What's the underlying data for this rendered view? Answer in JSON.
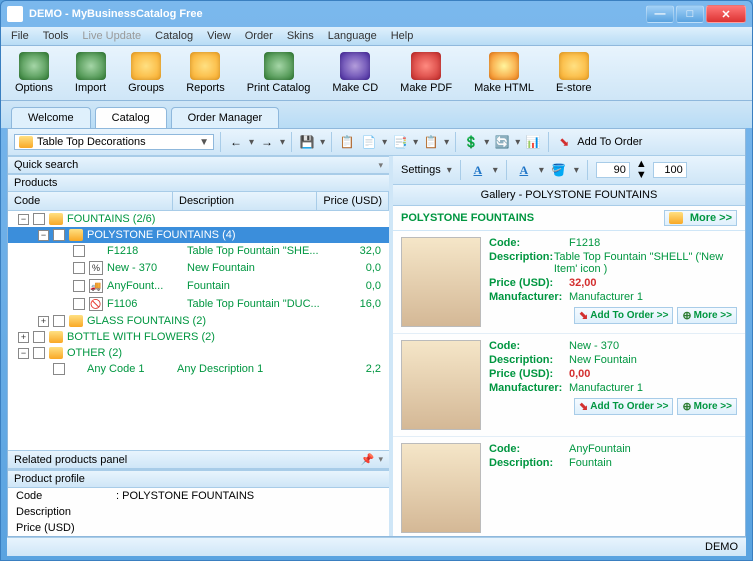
{
  "window": {
    "title": "DEMO - MyBusinessCatalog Free"
  },
  "menu": {
    "file": "File",
    "tools": "Tools",
    "live_update": "Live Update",
    "catalog": "Catalog",
    "view": "View",
    "order": "Order",
    "skins": "Skins",
    "language": "Language",
    "help": "Help"
  },
  "toolbar": {
    "options": "Options",
    "import": "Import",
    "groups": "Groups",
    "reports": "Reports",
    "print_catalog": "Print Catalog",
    "make_cd": "Make CD",
    "make_pdf": "Make PDF",
    "make_html": "Make HTML",
    "estore": "E-store"
  },
  "tabs": {
    "welcome": "Welcome",
    "catalog": "Catalog",
    "order_manager": "Order Manager"
  },
  "category_combo": "Table Top Decorations",
  "add_to_order": "Add To Order",
  "quick_search": "Quick search",
  "products_label": "Products",
  "columns": {
    "code": "Code",
    "description": "Description",
    "price": "Price (USD)"
  },
  "tree": [
    {
      "type": "cat",
      "level": 0,
      "exp": "-",
      "code": "FOUNTAINS   (2/6)"
    },
    {
      "type": "cat",
      "level": 1,
      "exp": "-",
      "code": "POLYSTONE FOUNTAINS   (4)",
      "selected": true
    },
    {
      "type": "item",
      "level": 2,
      "code": "F1218",
      "desc": "Table Top Fountain \"SHE...",
      "price": "32,0"
    },
    {
      "type": "item",
      "level": 2,
      "code": "New - 370",
      "desc": "New Fountain",
      "price": "0,0",
      "badge": "%"
    },
    {
      "type": "item",
      "level": 2,
      "code": "AnyFount...",
      "desc": "Fountain",
      "price": "0,0",
      "badge": "truck"
    },
    {
      "type": "item",
      "level": 2,
      "code": "F1106",
      "desc": "Table Top Fountain \"DUC...",
      "price": "16,0",
      "badge": "no"
    },
    {
      "type": "cat",
      "level": 1,
      "exp": "+",
      "code": "GLASS FOUNTAINS   (2)"
    },
    {
      "type": "cat",
      "level": 0,
      "exp": "+",
      "code": "BOTTLE WITH FLOWERS   (2)"
    },
    {
      "type": "cat",
      "level": 0,
      "exp": "-",
      "code": "OTHER   (2)"
    },
    {
      "type": "item",
      "level": 1,
      "code": "Any Code 1",
      "desc": "Any Description 1",
      "price": "2,2"
    }
  ],
  "related_panel": "Related products panel",
  "profile": {
    "header": "Product profile",
    "code_label": "Code",
    "code_value": ": POLYSTONE FOUNTAINS",
    "desc_label": "Description",
    "price_label": "Price (USD)"
  },
  "right": {
    "settings": "Settings",
    "num1": "90",
    "num2": "100",
    "gallery_header": "Gallery - POLYSTONE FOUNTAINS",
    "category": "POLYSTONE FOUNTAINS",
    "more": "More >>",
    "add_to_order": "Add To Order >>",
    "labels": {
      "code": "Code:",
      "description": "Description:",
      "price": "Price (USD):",
      "manufacturer": "Manufacturer:"
    },
    "items": [
      {
        "code": "F1218",
        "desc": "Table Top Fountain \"SHELL\"    ('New Item' icon )",
        "price": "32,00",
        "manufacturer": "Manufacturer 1",
        "actions": true
      },
      {
        "code": "New - 370",
        "desc": "New Fountain",
        "price": "0,00",
        "manufacturer": "Manufacturer 1",
        "actions": true
      },
      {
        "code": "AnyFountain",
        "desc": "Fountain",
        "actions": false
      }
    ]
  },
  "statusbar": "DEMO"
}
